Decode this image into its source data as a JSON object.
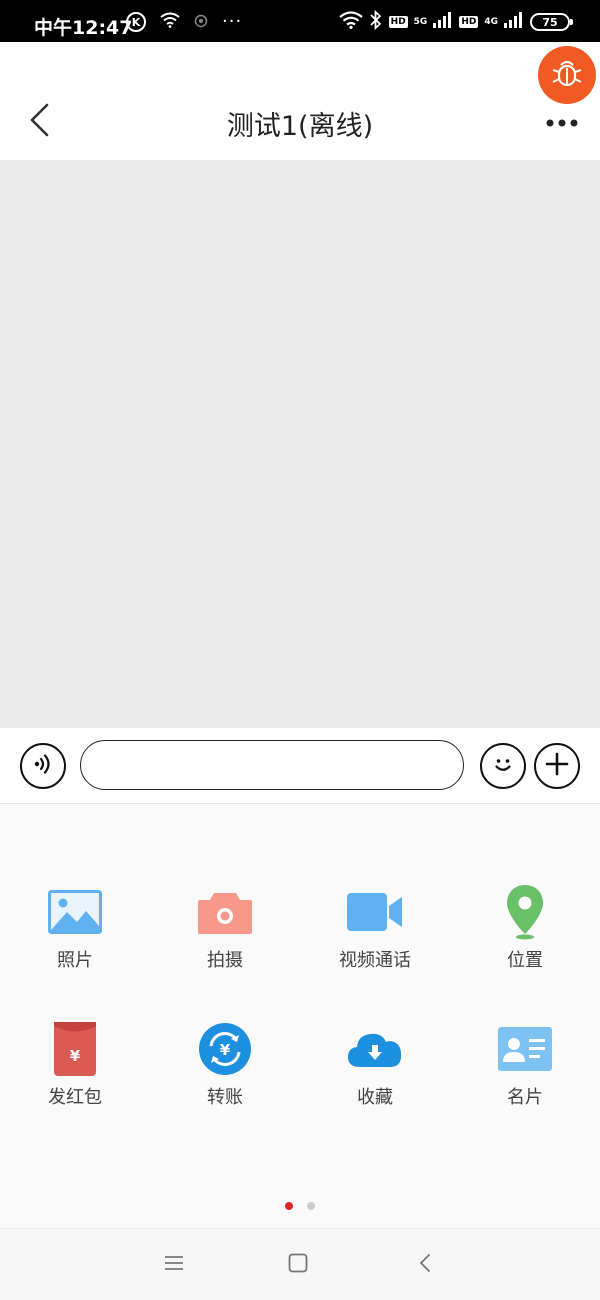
{
  "status_bar": {
    "time": "中午12:47",
    "k_badge": "K",
    "dots": "···",
    "hd1": "HD",
    "net1": "5G",
    "hd2": "HD",
    "net2": "4G",
    "battery": "75",
    "icons": [
      "k-circle-icon",
      "wifi-small-icon",
      "notification-icon",
      "wifi-icon",
      "bluetooth-icon",
      "signal-icon",
      "battery-icon"
    ]
  },
  "header": {
    "title": "测试1(离线)",
    "icons": [
      "back-arrow-icon",
      "more-dots-icon",
      "bug-icon"
    ],
    "bug_color": "#f15a22"
  },
  "chat": {
    "background": "#ececec"
  },
  "input_bar": {
    "message_value": "",
    "placeholder": "",
    "icons": [
      "voice-icon",
      "emoji-icon",
      "plus-icon"
    ]
  },
  "panel": {
    "items": [
      {
        "label": "照片",
        "icon": "photo-icon"
      },
      {
        "label": "拍摄",
        "icon": "camera-icon"
      },
      {
        "label": "视频通话",
        "icon": "video-call-icon"
      },
      {
        "label": "位置",
        "icon": "location-icon"
      },
      {
        "label": "发红包",
        "icon": "red-packet-icon"
      },
      {
        "label": "转账",
        "icon": "transfer-icon"
      },
      {
        "label": "收藏",
        "icon": "favorites-cloud-icon"
      },
      {
        "label": "名片",
        "icon": "contact-card-icon"
      }
    ],
    "page_count": 2,
    "active_page": 1,
    "colors": {
      "active_dot": "#d9262c",
      "inactive_dot": "#cccccc"
    }
  },
  "nav_bar": {
    "icons": [
      "menu-icon",
      "home-icon",
      "back-icon"
    ]
  }
}
